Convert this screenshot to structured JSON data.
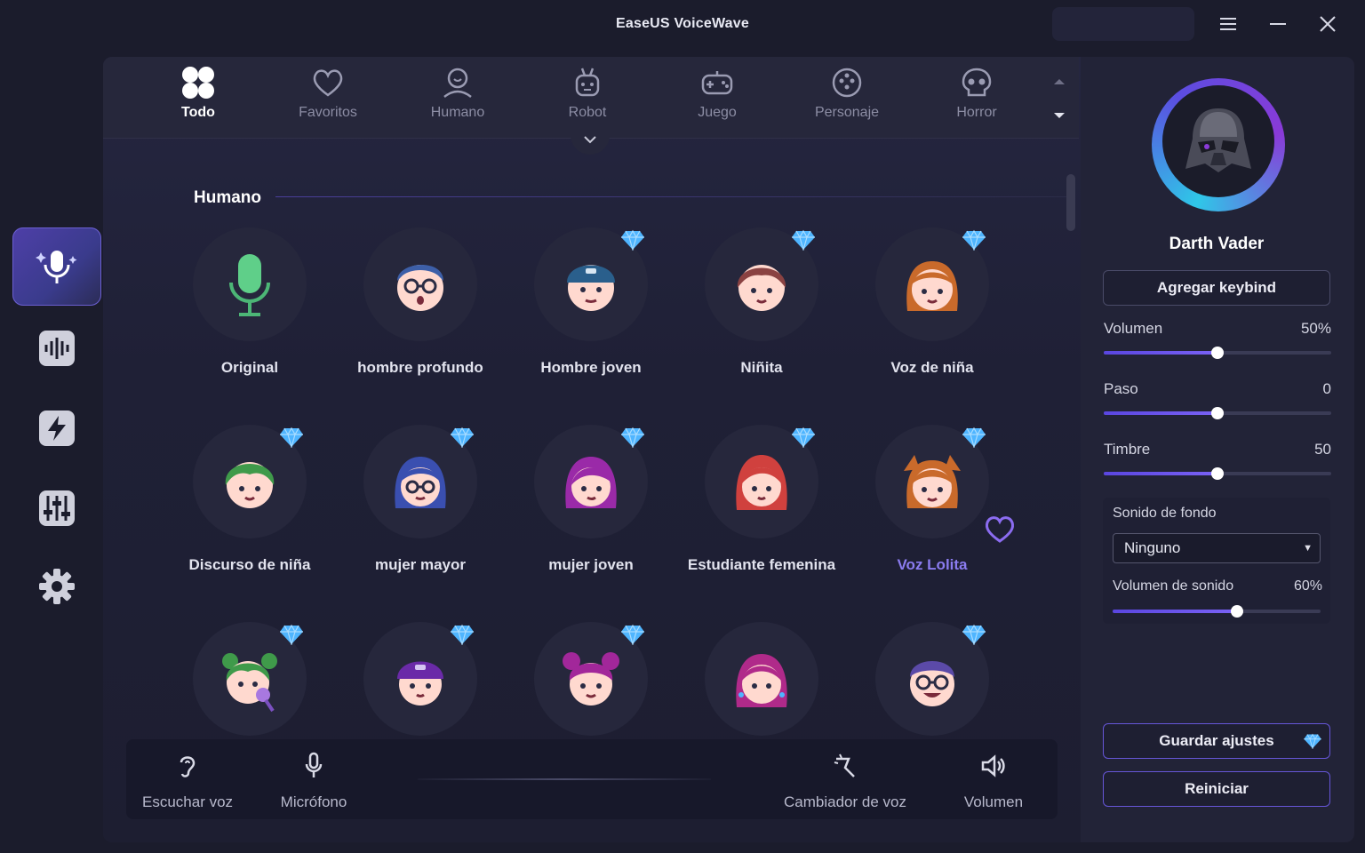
{
  "app": {
    "title": "EaseUS VoiceWave"
  },
  "tabs": [
    {
      "label": "Todo",
      "icon": "clover-icon",
      "active": true
    },
    {
      "label": "Favoritos",
      "icon": "heart-icon"
    },
    {
      "label": "Humano",
      "icon": "person-icon"
    },
    {
      "label": "Robot",
      "icon": "robot-icon"
    },
    {
      "label": "Juego",
      "icon": "gamepad-icon"
    },
    {
      "label": "Personaje",
      "icon": "character-icon"
    },
    {
      "label": "Horror",
      "icon": "skull-icon"
    }
  ],
  "sidebar": [
    {
      "name": "voice-changer",
      "icon": "microphone-sparkle-icon",
      "active": true
    },
    {
      "name": "soundboard",
      "icon": "waveform-icon"
    },
    {
      "name": "quick",
      "icon": "lightning-icon"
    },
    {
      "name": "mixer",
      "icon": "equalizer-icon"
    },
    {
      "name": "settings",
      "icon": "gear-icon"
    }
  ],
  "section": {
    "title": "Humano"
  },
  "voices": [
    {
      "name": "Original",
      "premium": false,
      "avatar": "microphone-icon"
    },
    {
      "name": "hombre profundo",
      "premium": false,
      "avatar": "man-glasses-avatar"
    },
    {
      "name": "Hombre joven",
      "premium": true,
      "avatar": "young-man-cap-avatar"
    },
    {
      "name": "Niñita",
      "premium": true,
      "avatar": "little-girl-avatar"
    },
    {
      "name": "Voz de niña",
      "premium": true,
      "avatar": "girl-avatar"
    },
    {
      "name": "Discurso de niña",
      "premium": true,
      "avatar": "green-girl-avatar"
    },
    {
      "name": "mujer mayor",
      "premium": true,
      "avatar": "older-woman-avatar"
    },
    {
      "name": "mujer joven",
      "premium": true,
      "avatar": "young-woman-avatar"
    },
    {
      "name": "Estudiante femenina",
      "premium": true,
      "avatar": "female-student-avatar"
    },
    {
      "name": "Voz Lolita",
      "premium": true,
      "avatar": "lolita-avatar",
      "selected": true,
      "favorite": true
    },
    {
      "name": "",
      "premium": true,
      "avatar": "girl-microphone-avatar"
    },
    {
      "name": "",
      "premium": true,
      "avatar": "purple-cap-avatar"
    },
    {
      "name": "",
      "premium": true,
      "avatar": "bun-girl-avatar"
    },
    {
      "name": "",
      "premium": false,
      "avatar": "pink-woman-avatar"
    },
    {
      "name": "",
      "premium": true,
      "avatar": "smiling-man-avatar"
    }
  ],
  "bottom": {
    "listen": "Escuchar voz",
    "mic": "Micrófono",
    "changer": "Cambiador de voz",
    "volume": "Volumen"
  },
  "right": {
    "current_voice": "Darth Vader",
    "keybind_btn": "Agregar keybind",
    "sliders": [
      {
        "label": "Volumen",
        "value_text": "50%",
        "value": 0.5
      },
      {
        "label": "Paso",
        "value_text": "0",
        "value": 0.5
      },
      {
        "label": "Timbre",
        "value_text": "50",
        "value": 0.5
      }
    ],
    "background": {
      "label": "Sonido de fondo",
      "selected": "Ninguno",
      "volume_label": "Volumen de sonido",
      "volume_text": "60%",
      "volume": 0.6
    },
    "save_btn": "Guardar ajustes",
    "reset_btn": "Reiniciar"
  },
  "colors": {
    "accent": "#6a55e6",
    "gem": "#4fb5ff",
    "selected_text": "#8b7cf0"
  }
}
